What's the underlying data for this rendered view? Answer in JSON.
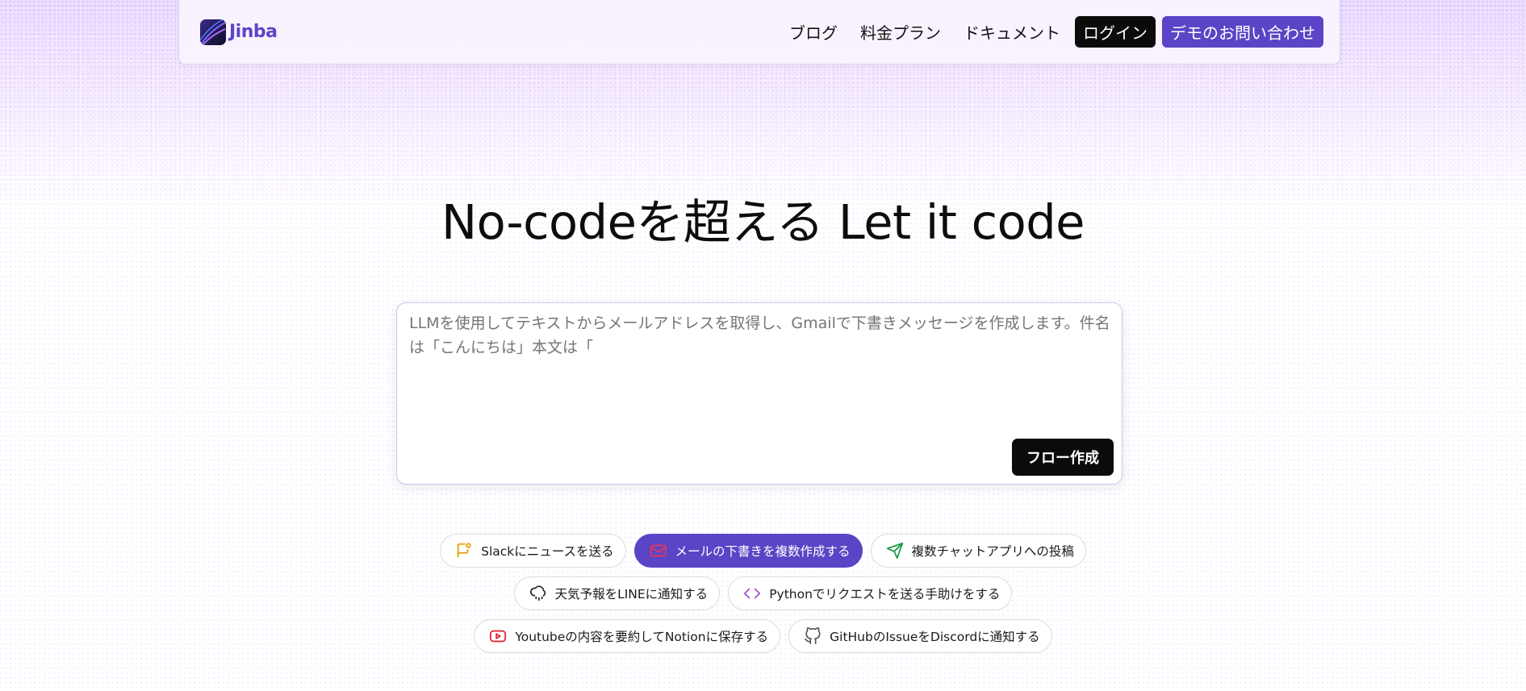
{
  "brand": {
    "name": "Jinba"
  },
  "nav": {
    "links": [
      "ブログ",
      "料金プラン",
      "ドキュメント"
    ],
    "login_label": "ログイン",
    "demo_label": "デモのお問い合わせ"
  },
  "hero": {
    "title": "No-codeを超える Let it code"
  },
  "prompt": {
    "placeholder": "LLMを使用してテキストからメールアドレスを取得し、Gmailで下書きメッセージを作成します。件名は「こんにちは」本文は「",
    "submit_label": "フロー作成"
  },
  "chips": {
    "row1": [
      {
        "label": "Slackにニュースを送る",
        "icon": "message-flag-icon",
        "color": "#e0a300",
        "active": false
      },
      {
        "label": "メールの下書きを複数作成する",
        "icon": "mail-icon",
        "color": "#e2365a",
        "active": true
      },
      {
        "label": "複数チャットアプリへの投稿",
        "icon": "send-icon",
        "color": "#1f9d4c",
        "active": false
      }
    ],
    "row2": [
      {
        "label": "天気予報をLINEに通知する",
        "icon": "cloud-rain-icon",
        "color": "#222222",
        "active": false
      },
      {
        "label": "Pythonでリクエストを送る手助けをする",
        "icon": "code-icon",
        "color": "#a64fd6",
        "active": false
      }
    ],
    "row3": [
      {
        "label": "Youtubeの内容を要約してNotionに保存する",
        "icon": "youtube-icon",
        "color": "#e0283a",
        "active": false
      },
      {
        "label": "GitHubのIssueをDiscordに通知する",
        "icon": "github-icon",
        "color": "#555555",
        "active": false
      }
    ]
  }
}
